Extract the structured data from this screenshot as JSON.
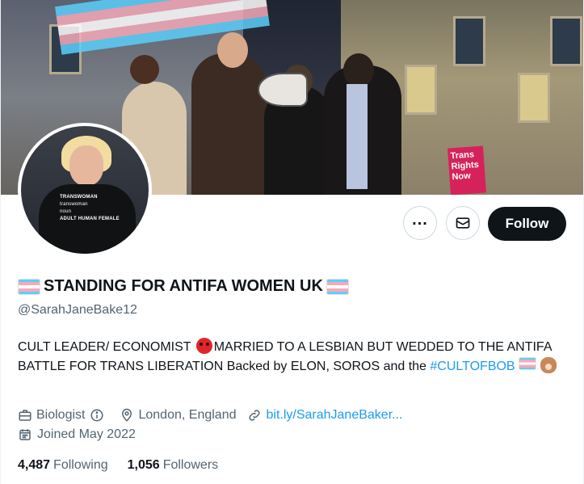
{
  "profile": {
    "display_name": "STANDING FOR ANTIFA WOMEN UK",
    "name_flag_icon": "transgender-flag-icon",
    "handle": "@SarahJaneBake12",
    "bio": {
      "part1": "CULT LEADER/ ECONOMIST ",
      "emoji1": "angry-face-icon",
      "part2": "MARRIED TO A LESBIAN BUT WEDDED TO THE ANTIFA BATTLE FOR TRANS LIBERATION Backed by ELON, SOROS and the ",
      "hashtag": "#CULTOFBOB",
      "emoji2": "dog-face-icon"
    },
    "category": "Biologist",
    "location": "London, England",
    "website": "bit.ly/SarahJaneBaker...",
    "joined": "Joined May 2022",
    "following_count": "4,487",
    "following_label": "Following",
    "followers_count": "1,056",
    "followers_label": "Followers"
  },
  "avatar_caption": {
    "line1": "TRANSWOMAN",
    "line2": "transwoman",
    "line3": "noun",
    "line4": "ADULT HUMAN FEMALE"
  },
  "banner_sign": "Trans Rights Now",
  "actions": {
    "more_icon": "more-horizontal-icon",
    "message_icon": "envelope-icon",
    "follow_label": "Follow"
  },
  "colors": {
    "accent": "#1d9bf0",
    "text": "#0f1419",
    "secondary": "#536471",
    "follow_bg": "#0f1419"
  }
}
